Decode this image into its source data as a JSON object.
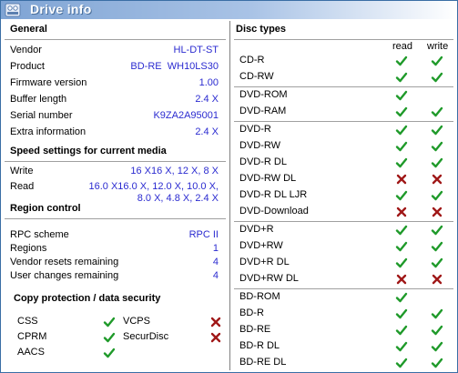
{
  "window": {
    "title": "Drive info",
    "icon": "drive-info-icon"
  },
  "general": {
    "heading": "General",
    "rows": [
      {
        "label": "Vendor",
        "value": "HL-DT-ST"
      },
      {
        "label": "Product",
        "value": "BD-RE  WH10LS30"
      },
      {
        "label": "Firmware version",
        "value": "1.00"
      },
      {
        "label": "Buffer length",
        "value": "2.4 X"
      },
      {
        "label": "Serial number",
        "value": "K9ZA2A95001"
      },
      {
        "label": "Extra information",
        "value": "2.4 X"
      }
    ]
  },
  "speed": {
    "heading": "Speed settings for current media",
    "write_label": "Write",
    "write_value": "16 X16 X, 12 X, 8 X",
    "read_label": "Read",
    "read_value_line1": "16.0 X16.0 X, 12.0 X, 10.0 X,",
    "read_value_line2": "8.0 X, 4.8 X, 2.4 X"
  },
  "region": {
    "heading": "Region control",
    "rows": [
      {
        "label": "RPC scheme",
        "value": "RPC II"
      },
      {
        "label": "Regions",
        "value": "1"
      },
      {
        "label": "Vendor resets remaining",
        "value": "4"
      },
      {
        "label": "User changes remaining",
        "value": "4"
      }
    ]
  },
  "copy_protection": {
    "heading": "Copy protection / data security",
    "items": [
      {
        "label": "CSS",
        "supported": true
      },
      {
        "label": "VCPS",
        "supported": false
      },
      {
        "label": "CPRM",
        "supported": true
      },
      {
        "label": "SecurDisc",
        "supported": false
      },
      {
        "label": "AACS",
        "supported": true
      }
    ]
  },
  "disc_types": {
    "heading": "Disc types",
    "read_header": "read",
    "write_header": "write",
    "groups": [
      [
        {
          "name": "CD-R",
          "read": true,
          "write": true
        },
        {
          "name": "CD-RW",
          "read": true,
          "write": true
        }
      ],
      [
        {
          "name": "DVD-ROM",
          "read": true,
          "write": null
        },
        {
          "name": "DVD-RAM",
          "read": true,
          "write": true
        }
      ],
      [
        {
          "name": "DVD-R",
          "read": true,
          "write": true
        },
        {
          "name": "DVD-RW",
          "read": true,
          "write": true
        },
        {
          "name": "DVD-R DL",
          "read": true,
          "write": true
        },
        {
          "name": "DVD-RW DL",
          "read": false,
          "write": false
        },
        {
          "name": "DVD-R DL LJR",
          "read": true,
          "write": true
        },
        {
          "name": "DVD-Download",
          "read": false,
          "write": false
        }
      ],
      [
        {
          "name": "DVD+R",
          "read": true,
          "write": true
        },
        {
          "name": "DVD+RW",
          "read": true,
          "write": true
        },
        {
          "name": "DVD+R DL",
          "read": true,
          "write": true
        },
        {
          "name": "DVD+RW DL",
          "read": false,
          "write": false
        }
      ],
      [
        {
          "name": "BD-ROM",
          "read": true,
          "write": null
        },
        {
          "name": "BD-R",
          "read": true,
          "write": true
        },
        {
          "name": "BD-RE",
          "read": true,
          "write": true
        },
        {
          "name": "BD-R DL",
          "read": true,
          "write": true
        },
        {
          "name": "BD-RE DL",
          "read": true,
          "write": true
        }
      ]
    ]
  },
  "colors": {
    "check": "#1f9a2a",
    "cross": "#a01818",
    "value": "#2b2bd0"
  }
}
